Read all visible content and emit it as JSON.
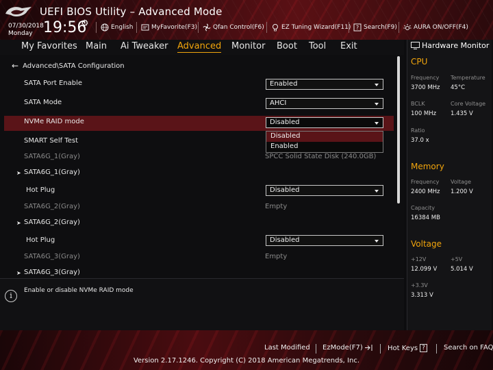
{
  "header": {
    "title": "UEFI BIOS Utility – Advanced Mode",
    "date": "07/30/2018",
    "day": "Monday",
    "time": "19:56",
    "items": [
      {
        "label": "English",
        "icon": "globe-icon"
      },
      {
        "label": "MyFavorite(F3)",
        "icon": "favorite-icon"
      },
      {
        "label": "Qfan Control(F6)",
        "icon": "fan-icon"
      },
      {
        "label": "EZ Tuning Wizard(F11)",
        "icon": "bulb-icon"
      },
      {
        "label": "Search(F9)",
        "icon": "search-icon"
      },
      {
        "label": "AURA ON/OFF(F4)",
        "icon": "aura-icon"
      }
    ]
  },
  "nav": {
    "tabs": [
      "My Favorites",
      "Main",
      "Ai Tweaker",
      "Advanced",
      "Monitor",
      "Boot",
      "Tool",
      "Exit"
    ],
    "active": "Advanced"
  },
  "main": {
    "breadcrumb": "Advanced\\SATA Configuration",
    "rows": {
      "sata_port_enable": {
        "label": "SATA Port Enable",
        "value": "Enabled"
      },
      "sata_mode": {
        "label": "SATA Mode",
        "value": "AHCI"
      },
      "nvme_raid": {
        "label": "NVMe RAID mode",
        "value": "Disabled"
      },
      "smart_self_test": {
        "label": "SMART Self Test"
      },
      "sata6g_1_info": {
        "label": "SATA6G_1(Gray)",
        "value": "SPCC Solid State Disk (240.0GB)"
      },
      "sata6g_1_group": {
        "label": "SATA6G_1(Gray)"
      },
      "hotplug_1": {
        "label": "Hot Plug",
        "value": "Disabled"
      },
      "sata6g_2_info": {
        "label": "SATA6G_2(Gray)",
        "value": "Empty"
      },
      "sata6g_2_group": {
        "label": "SATA6G_2(Gray)"
      },
      "hotplug_2": {
        "label": "Hot Plug",
        "value": "Disabled"
      },
      "sata6g_3_info": {
        "label": "SATA6G_3(Gray)",
        "value": "Empty"
      },
      "sata6g_3_group": {
        "label": "SATA6G_3(Gray)"
      }
    },
    "dropdown": {
      "options": [
        "Disabled",
        "Enabled"
      ],
      "selected": "Disabled"
    }
  },
  "help": {
    "text": "Enable or disable NVMe RAID mode"
  },
  "hardware_monitor": {
    "title": "Hardware Monitor",
    "cpu": {
      "heading": "CPU",
      "frequency_label": "Frequency",
      "frequency": "3700 MHz",
      "temperature_label": "Temperature",
      "temperature": "45°C",
      "bclk_label": "BCLK",
      "bclk": "100 MHz",
      "core_voltage_label": "Core Voltage",
      "core_voltage": "1.435 V",
      "ratio_label": "Ratio",
      "ratio": "37.0 x"
    },
    "memory": {
      "heading": "Memory",
      "frequency_label": "Frequency",
      "frequency": "2400 MHz",
      "voltage_label": "Voltage",
      "voltage": "1.200 V",
      "capacity_label": "Capacity",
      "capacity": "16384 MB"
    },
    "voltage": {
      "heading": "Voltage",
      "v12_label": "+12V",
      "v12": "12.099 V",
      "v5_label": "+5V",
      "v5": "5.014 V",
      "v33_label": "+3.3V",
      "v33": "3.313 V"
    }
  },
  "footer": {
    "last_modified": "Last Modified",
    "ezmode": "EzMode(F7)",
    "hot_keys": "Hot Keys",
    "hot_keys_key": "?",
    "search_faq": "Search on FAQ",
    "version": "Version 2.17.1246. Copyright (C) 2018 American Megatrends, Inc."
  },
  "colors": {
    "accent": "#f2a50c",
    "highlight": "#5a1418",
    "brand_red": "#c8141e"
  }
}
